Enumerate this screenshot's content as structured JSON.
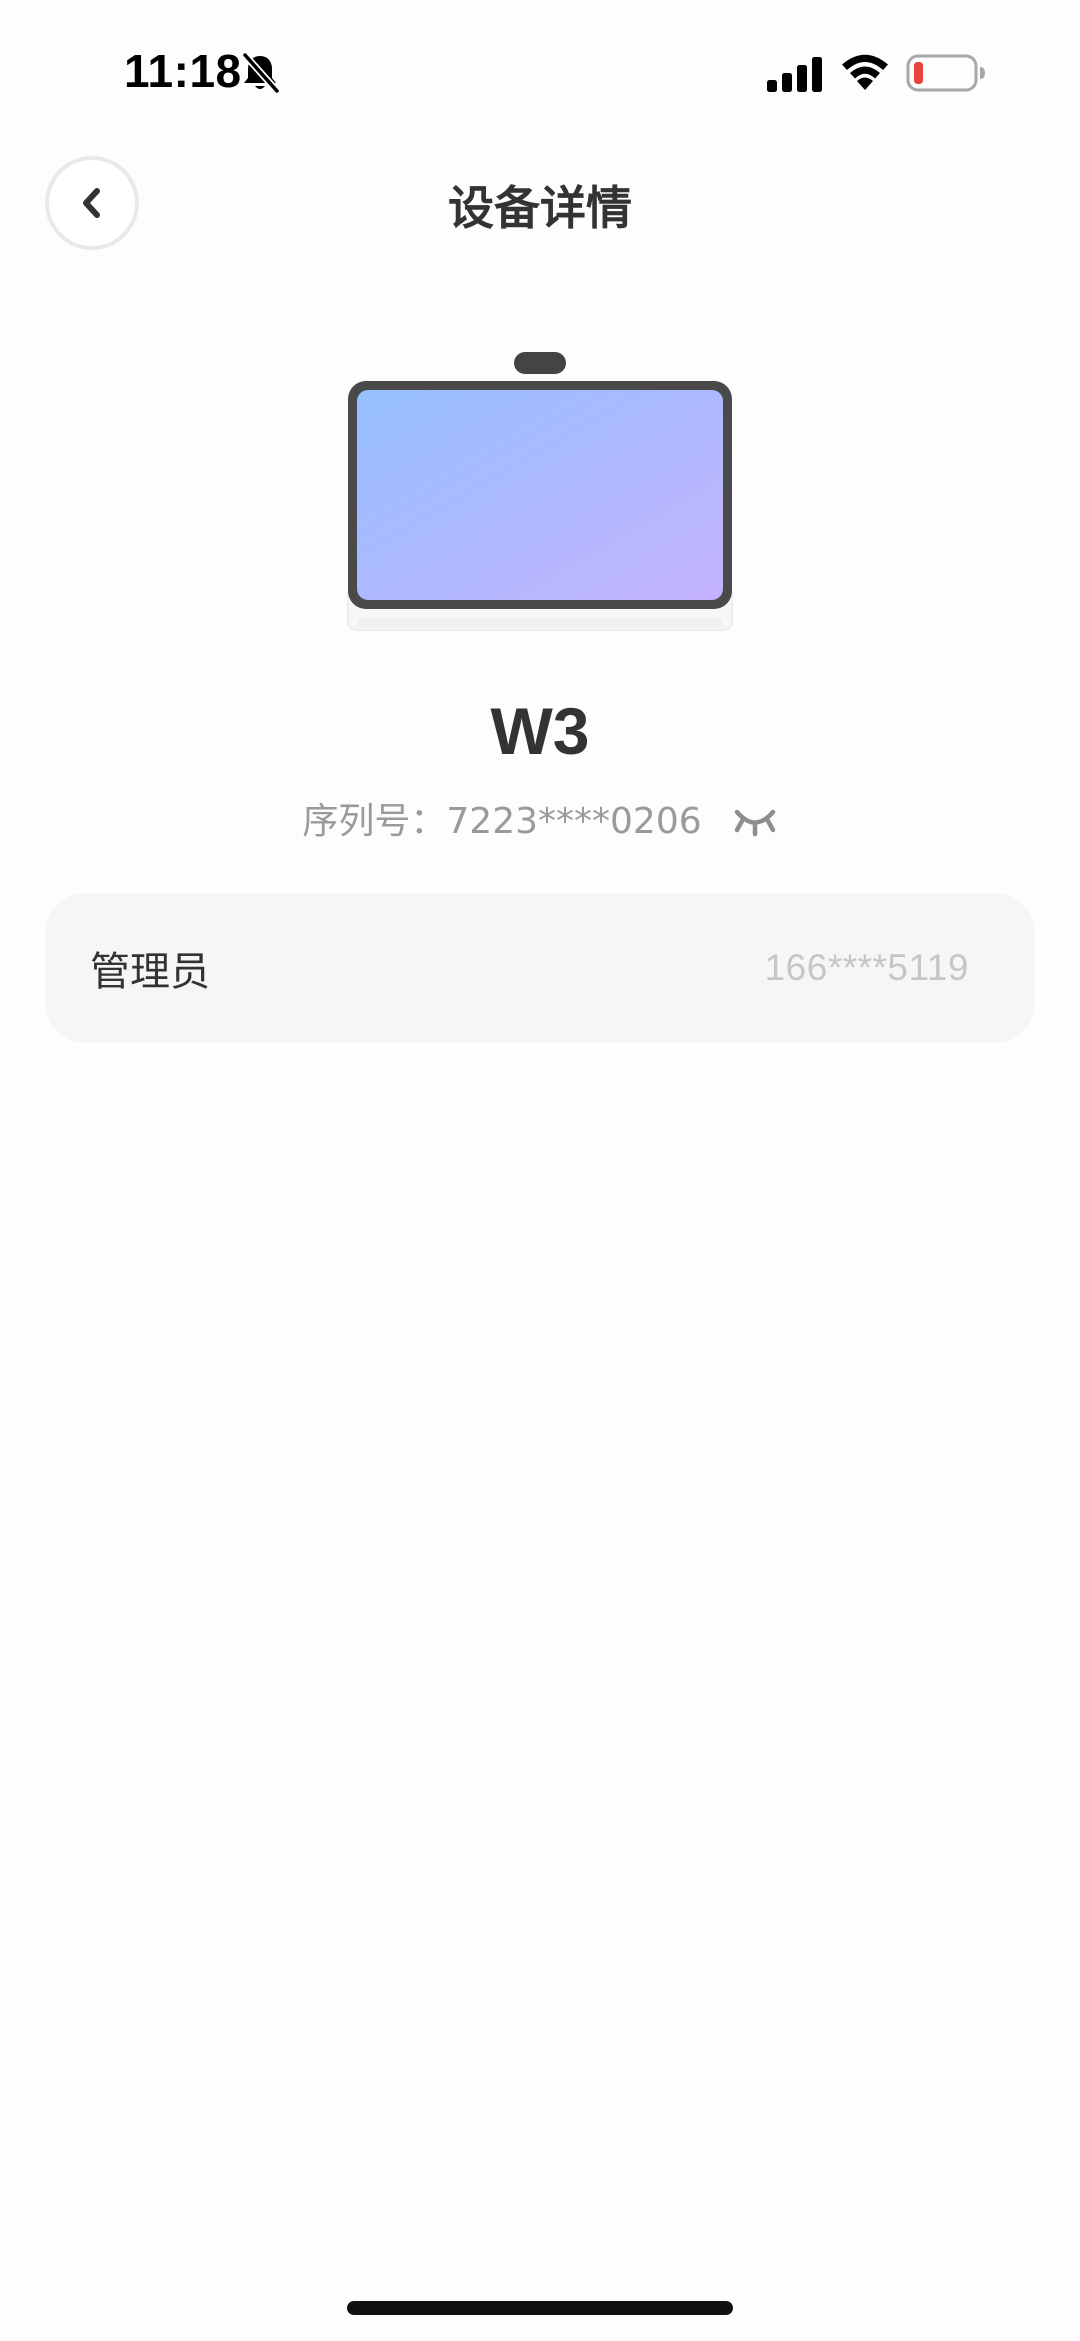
{
  "status_bar": {
    "time": "11:18",
    "icons": [
      "bell-muted-icon",
      "signal-icon",
      "wifi-icon",
      "battery-low-icon"
    ],
    "battery_color": "#E8453C"
  },
  "nav": {
    "title": "设备详情",
    "back_icon": "chevron-left-icon"
  },
  "device": {
    "name": "W3",
    "serial_label": "序列号：",
    "serial_value": "7223****0206",
    "visibility_icon": "eye-closed-icon",
    "screen_gradient": [
      "#9CC2FF",
      "#C2B3FF"
    ]
  },
  "admin": {
    "label": "管理员",
    "value": "166****5119"
  }
}
